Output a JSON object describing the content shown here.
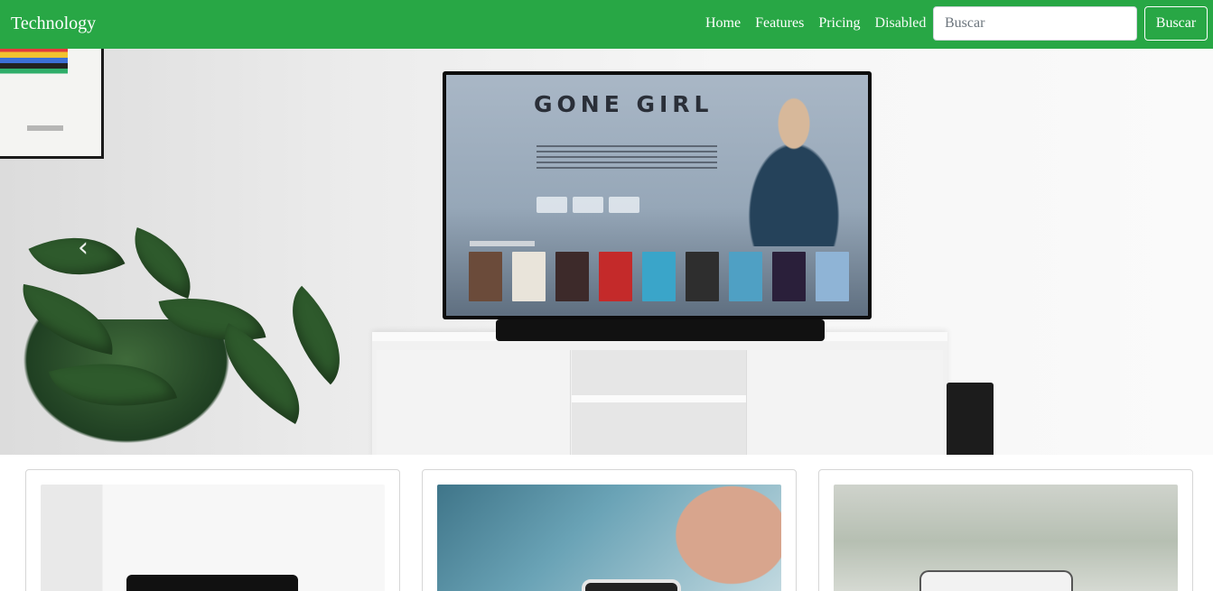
{
  "navbar": {
    "brand": "Technology",
    "links": [
      {
        "label": "Home"
      },
      {
        "label": "Features"
      },
      {
        "label": "Pricing"
      },
      {
        "label": "Disabled"
      }
    ],
    "search": {
      "placeholder": "Buscar",
      "button_label": "Buscar"
    },
    "background_color": "#28a745"
  },
  "hero": {
    "tv_title": "GONE GIRL",
    "prev_control_icon": "chevron-left-icon"
  },
  "cards": [
    {
      "image": "laptop-photo"
    },
    {
      "image": "smartwatch-photo"
    },
    {
      "image": "camera-photo"
    }
  ]
}
